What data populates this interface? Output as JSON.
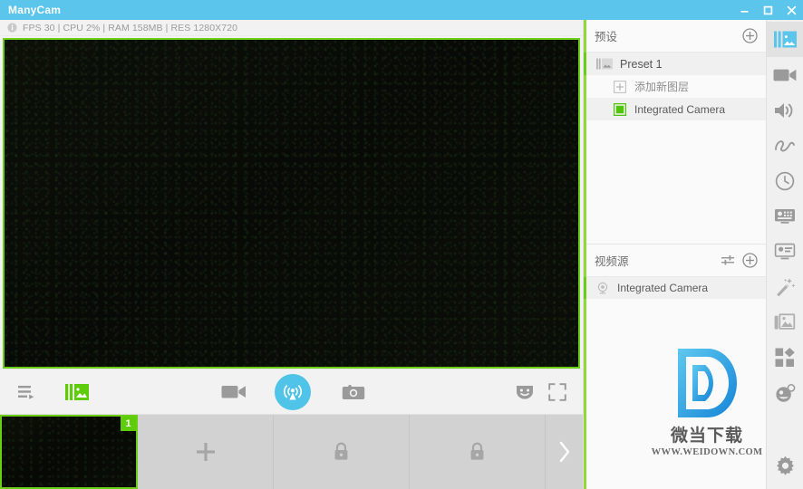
{
  "window": {
    "title": "ManyCam",
    "controls": [
      {
        "name": "minimize",
        "label": "–"
      },
      {
        "name": "maximize",
        "label": "□"
      },
      {
        "name": "close",
        "label": "✕"
      }
    ]
  },
  "infobar": {
    "icon": "info-icon",
    "text": "FPS 30 | CPU 2% | RAM 158MB | RES 1280X720",
    "fps": "30",
    "cpu": "2%",
    "ram": "158MB",
    "resolution": "1280X720"
  },
  "stage": {
    "border_color": "#6bcd16",
    "background_color": "#0a0d08"
  },
  "controlbar": {
    "playlist_label": "playlist-icon",
    "layers_label": "layers-icon",
    "record_label": "record-icon",
    "broadcast_label": "broadcast-icon",
    "snapshot_label": "snapshot-icon",
    "mask_label": "mask-icon",
    "fullscreen_label": "fullscreen-icon",
    "broadcast_color": "#4fc3e8",
    "layers_color": "#5ecc0a"
  },
  "thumbnails": {
    "items": [
      {
        "type": "video",
        "badge": "1",
        "active": true,
        "icon": ""
      },
      {
        "type": "add",
        "badge": "",
        "active": false,
        "icon": "plus-icon"
      },
      {
        "type": "locked",
        "badge": "",
        "active": false,
        "icon": "lock-icon"
      },
      {
        "type": "locked",
        "badge": "",
        "active": false,
        "icon": "lock-icon"
      }
    ],
    "next_label": "chevron-right-icon"
  },
  "presets_panel": {
    "title": "预设",
    "add_label": "plus-circle-icon",
    "preset": {
      "label": "Preset 1",
      "icon": "layers-thumb-icon"
    },
    "layers": [
      {
        "label": "添加新图层",
        "icon": "add-layer-icon",
        "type": "add"
      },
      {
        "label": "Integrated Camera",
        "icon": "green-square-icon",
        "type": "camera"
      }
    ]
  },
  "video_source_panel": {
    "title": "视频源",
    "settings_label": "sliders-icon",
    "add_label": "plus-circle-icon",
    "sources": [
      {
        "label": "Integrated Camera",
        "icon": "webcam-icon",
        "active": true
      }
    ]
  },
  "rail": {
    "items": [
      {
        "name": "layers",
        "icon": "layers-icon",
        "active": true
      },
      {
        "name": "video",
        "icon": "video-camera-icon",
        "active": false
      },
      {
        "name": "audio",
        "icon": "speaker-icon",
        "active": false
      },
      {
        "name": "draw",
        "icon": "scribble-icon",
        "active": false
      },
      {
        "name": "schedule",
        "icon": "clock-icon",
        "active": false
      },
      {
        "name": "chroma",
        "icon": "chroma-key-icon",
        "active": false
      },
      {
        "name": "lower-third",
        "icon": "lower-third-icon",
        "active": false
      },
      {
        "name": "effects",
        "icon": "magic-wand-icon",
        "active": false
      },
      {
        "name": "media",
        "icon": "gallery-icon",
        "active": false
      },
      {
        "name": "apps",
        "icon": "grid-apps-icon",
        "active": false
      },
      {
        "name": "masks",
        "icon": "face-mask-icon",
        "active": false
      },
      {
        "name": "settings",
        "icon": "gear-icon",
        "active": false
      }
    ]
  },
  "watermark": {
    "logo": "D",
    "chinese": "微当下载",
    "url": "WWW.WEIDOWN.COM",
    "color": "#3fa9e8"
  }
}
